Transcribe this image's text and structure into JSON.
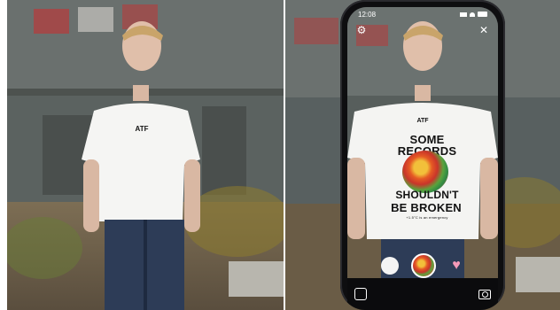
{
  "status_bar": {
    "time": "12:08"
  },
  "ar_controls": {
    "settings_icon": "gear-icon",
    "close_icon": "close-icon"
  },
  "tshirt": {
    "logo": "ATF",
    "line1": "SOME",
    "line2": "RECORDS",
    "line3": "SHOULDN'T",
    "line4": "BE BROKEN",
    "small_text": "+1.5°C is an emergency"
  },
  "filters": [
    "white-filter",
    "earth-filter",
    "pink-filter"
  ],
  "bottom_bar": {
    "gallery_icon": "gallery-icon",
    "camera_icon": "camera-flip-icon"
  },
  "colors": {
    "phone_frame": "#0e0e10",
    "earth_red": "#d1402e",
    "earth_green": "#5aa33c",
    "pink": "#f59ab9"
  }
}
